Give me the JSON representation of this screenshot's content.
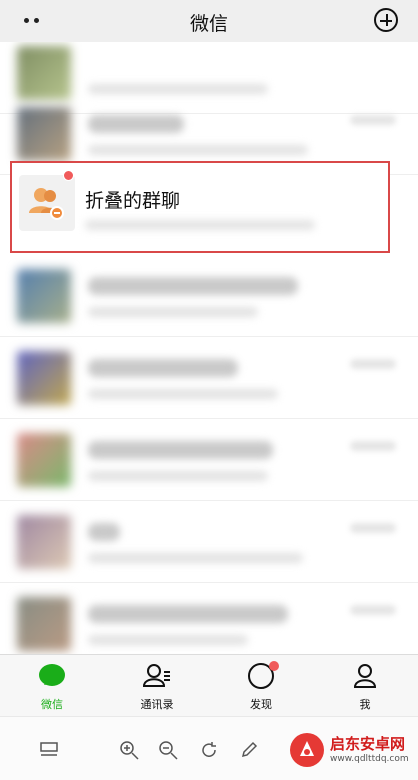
{
  "header": {
    "title": "微信"
  },
  "folded_group": {
    "title": "折叠的群聊"
  },
  "tabs": [
    {
      "label": "微信"
    },
    {
      "label": "通讯录"
    },
    {
      "label": "发现"
    },
    {
      "label": "我"
    }
  ],
  "watermark": {
    "text": "启东安卓网",
    "url": "www.qdlttdq.com"
  },
  "colors": {
    "accent": "#1aad19",
    "highlight_border": "#d94848",
    "badge": "#f05a5a"
  }
}
